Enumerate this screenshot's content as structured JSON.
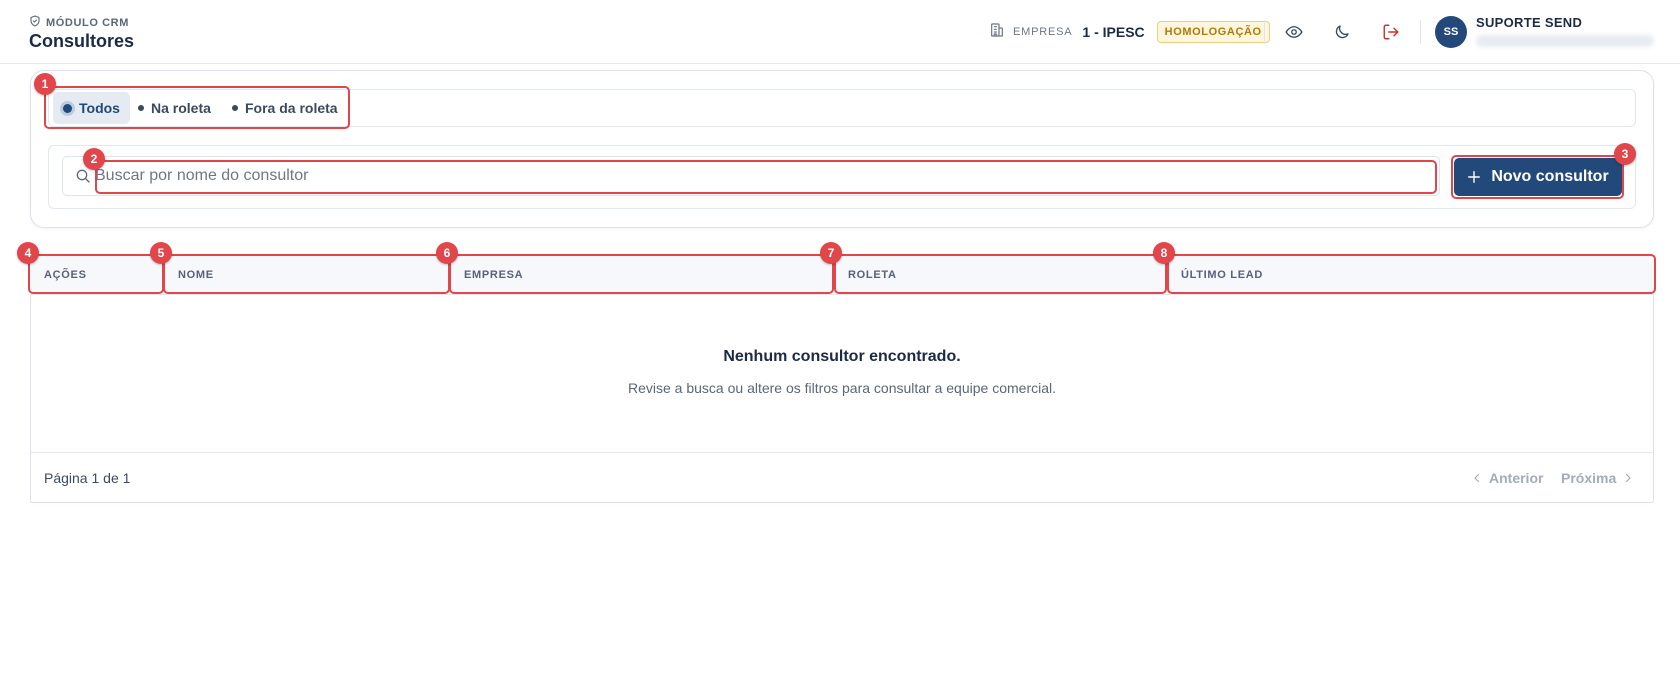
{
  "header": {
    "module_label": "MÓDULO CRM",
    "page_title": "Consultores",
    "company_label": "EMPRESA",
    "company_value": "1 - IPESC",
    "environment_badge": "HOMOLOGAÇÃO",
    "user_initials": "SS",
    "user_name": "SUPORTE SEND"
  },
  "filters": {
    "tabs": [
      {
        "label": "Todos",
        "active": true
      },
      {
        "label": "Na roleta",
        "active": false
      },
      {
        "label": "Fora da roleta",
        "active": false
      }
    ]
  },
  "search": {
    "placeholder": "Buscar por nome do consultor",
    "value": ""
  },
  "actions": {
    "new_consultant_label": "Novo consultor"
  },
  "table": {
    "columns": [
      "AÇÕES",
      "NOME",
      "EMPRESA",
      "ROLETA",
      "ÚLTIMO LEAD"
    ],
    "rows": [],
    "empty_title": "Nenhum consultor encontrado.",
    "empty_subtitle": "Revise a busca ou altere os filtros para consultar a equipe comercial."
  },
  "pagination": {
    "info": "Página 1 de 1",
    "prev_label": "Anterior",
    "next_label": "Próxima"
  },
  "annotations": [
    "1",
    "2",
    "3",
    "4",
    "5",
    "6",
    "7",
    "8"
  ],
  "colors": {
    "primary": "#23497a",
    "annotation": "#e0464a",
    "badge_text": "#b07a0d",
    "badge_bg": "#fdf5dc",
    "logout": "#d0312d"
  }
}
